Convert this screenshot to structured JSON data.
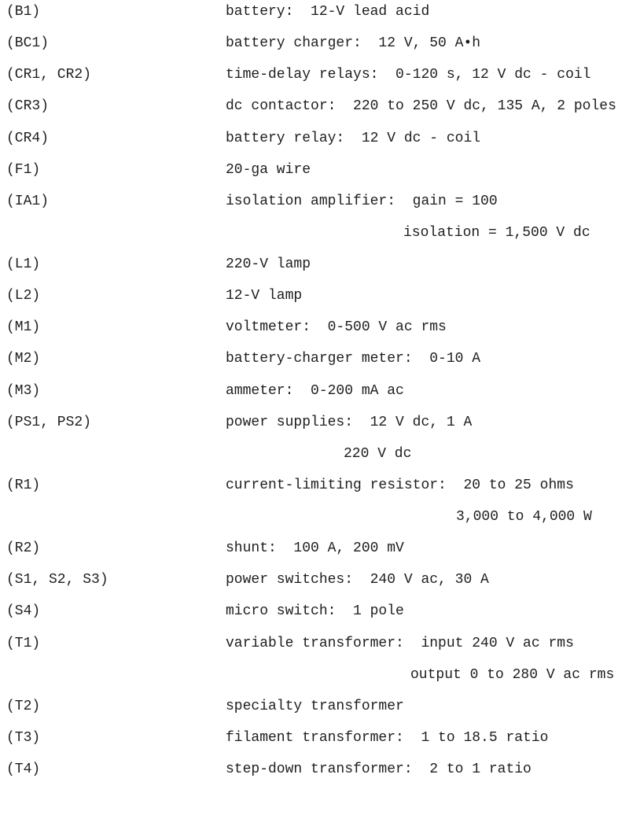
{
  "components": [
    {
      "id": "(B1)",
      "lines": [
        "battery:  12-V lead acid"
      ]
    },
    {
      "id": "(BC1)",
      "lines": [
        "battery charger:  12 V, 50 A•h"
      ]
    },
    {
      "id": "(CR1, CR2)",
      "lines": [
        "time-delay relays:  0-120 s, 12 V dc - coil"
      ]
    },
    {
      "id": "(CR3)",
      "lines": [
        "dc contactor:  220 to 250 V dc, 135 A, 2 poles"
      ]
    },
    {
      "id": "(CR4)",
      "lines": [
        "battery relay:  12 V dc - coil"
      ]
    },
    {
      "id": "(F1)",
      "lines": [
        "20-ga wire"
      ]
    },
    {
      "id": "(IA1)",
      "lines": [
        "isolation amplifier:  gain = 100",
        "isolation = 1,500 V dc"
      ]
    },
    {
      "id": "(L1)",
      "lines": [
        "220-V lamp"
      ]
    },
    {
      "id": "(L2)",
      "lines": [
        "12-V lamp"
      ]
    },
    {
      "id": "(M1)",
      "lines": [
        "voltmeter:  0-500 V ac rms"
      ]
    },
    {
      "id": "(M2)",
      "lines": [
        "battery-charger meter:  0-10 A"
      ]
    },
    {
      "id": "(M3)",
      "lines": [
        "ammeter:  0-200 mA ac"
      ]
    },
    {
      "id": "(PS1, PS2)",
      "lines": [
        "power supplies:  12 V dc, 1 A",
        "220 V dc"
      ]
    },
    {
      "id": "(R1)",
      "lines": [
        "current-limiting resistor:  20 to 25 ohms",
        "3,000 to 4,000 W"
      ]
    },
    {
      "id": "(R2)",
      "lines": [
        "shunt:  100 A, 200 mV"
      ]
    },
    {
      "id": "(S1, S2, S3)",
      "lines": [
        "power switches:  240 V ac, 30 A"
      ]
    },
    {
      "id": "(S4)",
      "lines": [
        "micro switch:  1 pole"
      ]
    },
    {
      "id": "(T1)",
      "lines": [
        "variable transformer:  input 240 V ac rms",
        "output 0 to 280 V ac rms"
      ]
    },
    {
      "id": "(T2)",
      "lines": [
        "specialty transformer"
      ]
    },
    {
      "id": "(T3)",
      "lines": [
        "filament transformer:  1 to 18.5 ratio"
      ]
    },
    {
      "id": "(T4)",
      "lines": [
        "step-down transformer:  2 to 1 ratio"
      ]
    }
  ]
}
